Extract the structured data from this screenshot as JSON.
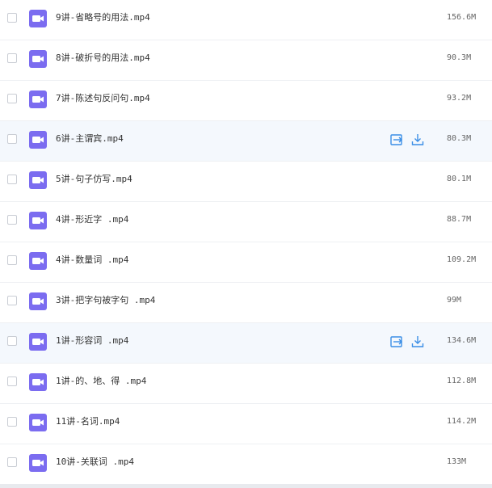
{
  "colors": {
    "icon_purple": "#7b6cf0",
    "action_blue": "#3a8ee6",
    "hover_row_bg": "#f4f8fd"
  },
  "files": [
    {
      "name": "9讲-省略号的用法.mp4",
      "size": "156.6M",
      "hover": false
    },
    {
      "name": "8讲-破折号的用法.mp4",
      "size": "90.3M",
      "hover": false
    },
    {
      "name": "7讲-陈述句反问句.mp4",
      "size": "93.2M",
      "hover": false
    },
    {
      "name": "6讲-主谓宾.mp4",
      "size": "80.3M",
      "hover": true
    },
    {
      "name": "5讲-句子仿写.mp4",
      "size": "80.1M",
      "hover": false
    },
    {
      "name": "4讲-形近字 .mp4",
      "size": "88.7M",
      "hover": false
    },
    {
      "name": "4讲-数量词 .mp4",
      "size": "109.2M",
      "hover": false
    },
    {
      "name": "3讲-把字句被字句 .mp4",
      "size": "99M",
      "hover": false
    },
    {
      "name": "1讲-形容词 .mp4",
      "size": "134.6M",
      "hover": true
    },
    {
      "name": "1讲-的、地、得 .mp4",
      "size": "112.8M",
      "hover": false
    },
    {
      "name": "11讲-名词.mp4",
      "size": "114.2M",
      "hover": false
    },
    {
      "name": "10讲-关联词 .mp4",
      "size": "133M",
      "hover": false
    }
  ]
}
